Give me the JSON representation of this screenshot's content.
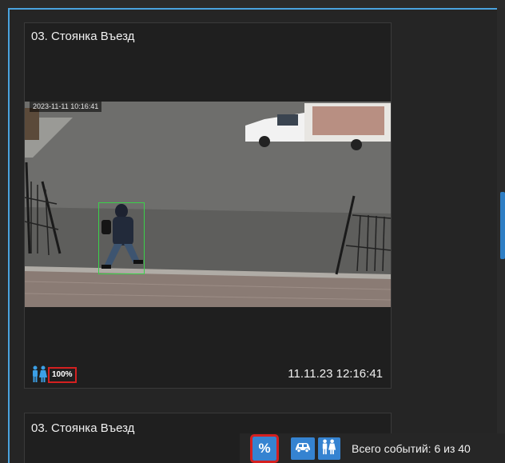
{
  "card1": {
    "title": "03. Стоянка Въезд",
    "video_timestamp": "2023-11-11 10:16:41",
    "detection": {
      "class_icon": "pedestrian-icon",
      "confidence_label": "100%"
    },
    "event_time": "11.11.23 12:16:41"
  },
  "card2": {
    "title": "03. Стоянка Въезд"
  },
  "toolbar": {
    "percent_label": "%",
    "car_filter_icon": "car-icon",
    "people_filter_icon": "people-icon",
    "events_total": "Всего событий: 6 из 40"
  },
  "colors": {
    "accent": "#3583d1",
    "highlight": "#d42020",
    "detection_box": "#3bd14a"
  }
}
